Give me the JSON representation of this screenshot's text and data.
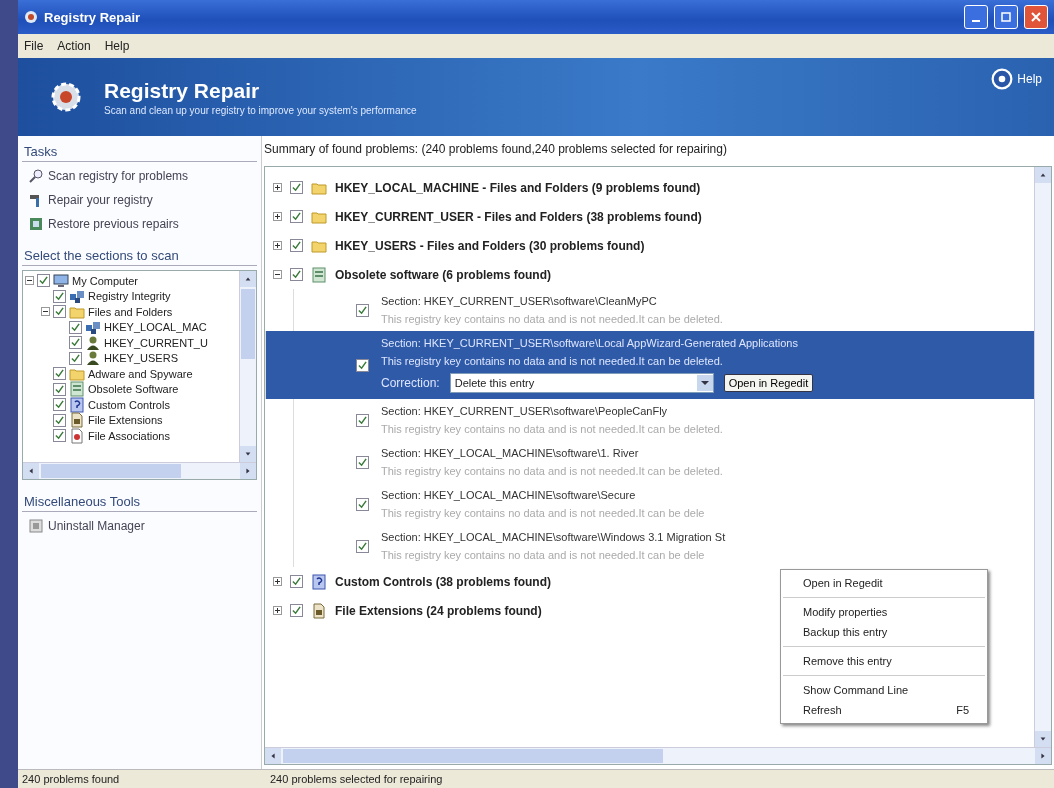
{
  "window": {
    "title": "Registry Repair"
  },
  "menu": [
    "File",
    "Action",
    "Help"
  ],
  "header": {
    "title": "Registry Repair",
    "subtitle": "Scan and clean up your registry to improve your system's performance",
    "help": "Help"
  },
  "tasks": {
    "title": "Tasks",
    "items": [
      {
        "label": "Scan registry for problems",
        "kind": "scan"
      },
      {
        "label": "Repair your registry",
        "kind": "repair"
      },
      {
        "label": "Restore previous repairs",
        "kind": "restore"
      }
    ]
  },
  "sections": {
    "title": "Select the sections to scan",
    "tree": [
      {
        "label": "My Computer",
        "checked": true,
        "expanded": true,
        "kind": "computer",
        "children": [
          {
            "label": "Registry Integrity",
            "checked": true,
            "kind": "registry"
          },
          {
            "label": "Files and Folders",
            "checked": true,
            "expanded": true,
            "kind": "folder",
            "children": [
              {
                "label": "HKEY_LOCAL_MAC",
                "checked": true,
                "kind": "registry"
              },
              {
                "label": "HKEY_CURRENT_U",
                "checked": true,
                "kind": "user"
              },
              {
                "label": "HKEY_USERS",
                "checked": true,
                "kind": "user"
              }
            ]
          },
          {
            "label": "Adware and Spyware",
            "checked": true,
            "kind": "folder"
          },
          {
            "label": "Obsolete Software",
            "checked": true,
            "kind": "software"
          },
          {
            "label": "Custom Controls",
            "checked": true,
            "kind": "control"
          },
          {
            "label": "File Extensions",
            "checked": true,
            "kind": "extension"
          },
          {
            "label": "File Associations",
            "checked": true,
            "kind": "association"
          }
        ]
      }
    ]
  },
  "misc": {
    "title": "Miscellaneous Tools",
    "items": [
      {
        "label": "Uninstall Manager"
      }
    ]
  },
  "summary": "Summary of found problems:  (240 problems found,240 problems selected for repairing)",
  "groups": [
    {
      "label": "HKEY_LOCAL_MACHINE - Files and Folders  (9 problems found)",
      "kind": "folder",
      "checked": true,
      "expanded": false
    },
    {
      "label": "HKEY_CURRENT_USER - Files and Folders  (38 problems found)",
      "kind": "folder",
      "checked": true,
      "expanded": false
    },
    {
      "label": "HKEY_USERS - Files and Folders  (30 problems found)",
      "kind": "folder",
      "checked": true,
      "expanded": false
    },
    {
      "label": "Obsolete software  (6 problems found)",
      "kind": "software",
      "checked": true,
      "expanded": true,
      "entries": [
        {
          "section": "Section: HKEY_CURRENT_USER\\software\\CleanMyPC",
          "description": "This registry key contains no data and is not needed.It can be deleted.",
          "checked": true,
          "selected": false
        },
        {
          "section": "Section: HKEY_CURRENT_USER\\software\\Local AppWizard-Generated Applications",
          "description": "This registry key contains no data and is not needed.It can be deleted.",
          "checked": true,
          "selected": true,
          "correction_label": "Correction:",
          "correction": "Delete this entry",
          "action": "Open in Regedit"
        },
        {
          "section": "Section: HKEY_CURRENT_USER\\software\\PeopleCanFly",
          "description": "This registry key contains no data and is not needed.It can be deleted.",
          "checked": true,
          "selected": false
        },
        {
          "section": "Section: HKEY_LOCAL_MACHINE\\software\\1. River",
          "description": "This registry key contains no data and is not needed.It can be deleted.",
          "checked": true,
          "selected": false
        },
        {
          "section": "Section: HKEY_LOCAL_MACHINE\\software\\Secure",
          "description": "This registry key contains no data and is not needed.It can be dele",
          "checked": true,
          "selected": false
        },
        {
          "section": "Section: HKEY_LOCAL_MACHINE\\software\\Windows 3.1 Migration St",
          "description": "This registry key contains no data and is not needed.It can be dele",
          "checked": true,
          "selected": false
        }
      ]
    },
    {
      "label": "Custom Controls  (38 problems found)",
      "kind": "control",
      "checked": true,
      "expanded": false
    },
    {
      "label": "File Extensions  (24 problems found)",
      "kind": "extension",
      "checked": true,
      "expanded": false
    }
  ],
  "context_menu": [
    [
      {
        "label": "Open in Regedit"
      }
    ],
    [
      {
        "label": "Modify properties"
      },
      {
        "label": "Backup this entry"
      }
    ],
    [
      {
        "label": "Remove this entry"
      }
    ],
    [
      {
        "label": "Show Command Line"
      },
      {
        "label": "Refresh",
        "shortcut": "F5"
      }
    ]
  ],
  "status_bar": [
    "240 problems found",
    "240 problems selected for repairing"
  ]
}
